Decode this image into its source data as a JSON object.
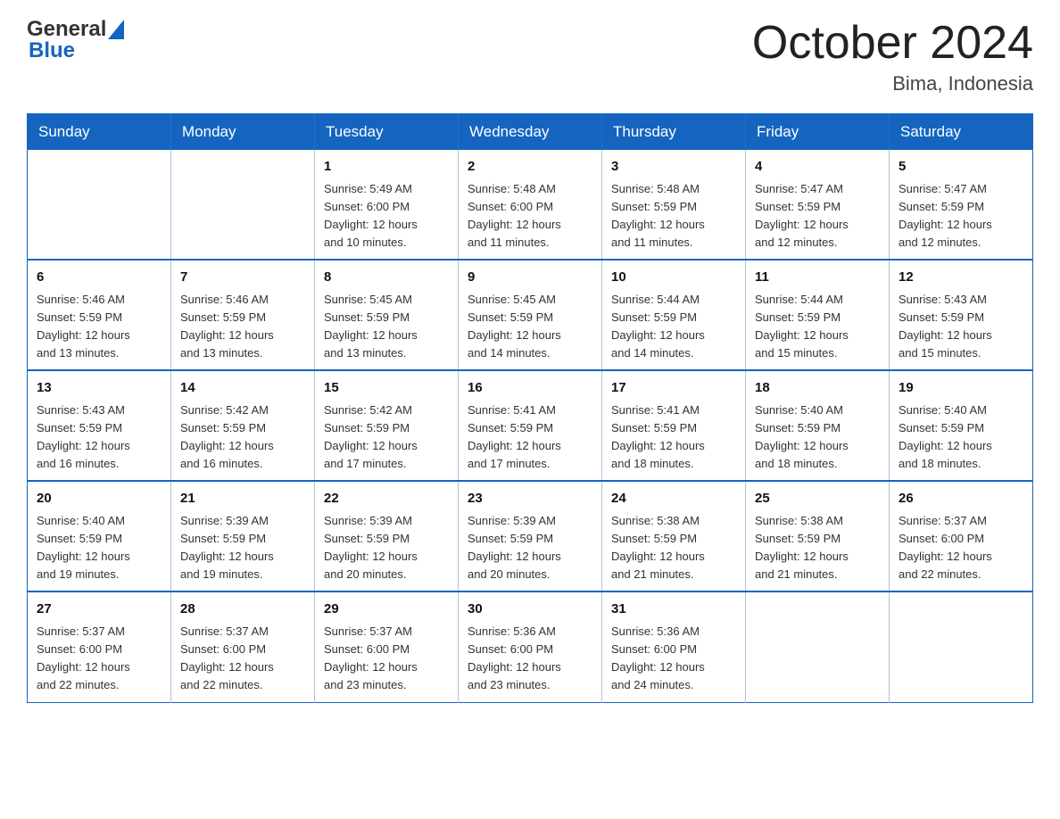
{
  "header": {
    "logo_text_general": "General",
    "logo_text_blue": "Blue",
    "month_title": "October 2024",
    "location": "Bima, Indonesia"
  },
  "calendar": {
    "days_of_week": [
      "Sunday",
      "Monday",
      "Tuesday",
      "Wednesday",
      "Thursday",
      "Friday",
      "Saturday"
    ],
    "weeks": [
      [
        {
          "day": "",
          "info": ""
        },
        {
          "day": "",
          "info": ""
        },
        {
          "day": "1",
          "info": "Sunrise: 5:49 AM\nSunset: 6:00 PM\nDaylight: 12 hours\nand 10 minutes."
        },
        {
          "day": "2",
          "info": "Sunrise: 5:48 AM\nSunset: 6:00 PM\nDaylight: 12 hours\nand 11 minutes."
        },
        {
          "day": "3",
          "info": "Sunrise: 5:48 AM\nSunset: 5:59 PM\nDaylight: 12 hours\nand 11 minutes."
        },
        {
          "day": "4",
          "info": "Sunrise: 5:47 AM\nSunset: 5:59 PM\nDaylight: 12 hours\nand 12 minutes."
        },
        {
          "day": "5",
          "info": "Sunrise: 5:47 AM\nSunset: 5:59 PM\nDaylight: 12 hours\nand 12 minutes."
        }
      ],
      [
        {
          "day": "6",
          "info": "Sunrise: 5:46 AM\nSunset: 5:59 PM\nDaylight: 12 hours\nand 13 minutes."
        },
        {
          "day": "7",
          "info": "Sunrise: 5:46 AM\nSunset: 5:59 PM\nDaylight: 12 hours\nand 13 minutes."
        },
        {
          "day": "8",
          "info": "Sunrise: 5:45 AM\nSunset: 5:59 PM\nDaylight: 12 hours\nand 13 minutes."
        },
        {
          "day": "9",
          "info": "Sunrise: 5:45 AM\nSunset: 5:59 PM\nDaylight: 12 hours\nand 14 minutes."
        },
        {
          "day": "10",
          "info": "Sunrise: 5:44 AM\nSunset: 5:59 PM\nDaylight: 12 hours\nand 14 minutes."
        },
        {
          "day": "11",
          "info": "Sunrise: 5:44 AM\nSunset: 5:59 PM\nDaylight: 12 hours\nand 15 minutes."
        },
        {
          "day": "12",
          "info": "Sunrise: 5:43 AM\nSunset: 5:59 PM\nDaylight: 12 hours\nand 15 minutes."
        }
      ],
      [
        {
          "day": "13",
          "info": "Sunrise: 5:43 AM\nSunset: 5:59 PM\nDaylight: 12 hours\nand 16 minutes."
        },
        {
          "day": "14",
          "info": "Sunrise: 5:42 AM\nSunset: 5:59 PM\nDaylight: 12 hours\nand 16 minutes."
        },
        {
          "day": "15",
          "info": "Sunrise: 5:42 AM\nSunset: 5:59 PM\nDaylight: 12 hours\nand 17 minutes."
        },
        {
          "day": "16",
          "info": "Sunrise: 5:41 AM\nSunset: 5:59 PM\nDaylight: 12 hours\nand 17 minutes."
        },
        {
          "day": "17",
          "info": "Sunrise: 5:41 AM\nSunset: 5:59 PM\nDaylight: 12 hours\nand 18 minutes."
        },
        {
          "day": "18",
          "info": "Sunrise: 5:40 AM\nSunset: 5:59 PM\nDaylight: 12 hours\nand 18 minutes."
        },
        {
          "day": "19",
          "info": "Sunrise: 5:40 AM\nSunset: 5:59 PM\nDaylight: 12 hours\nand 18 minutes."
        }
      ],
      [
        {
          "day": "20",
          "info": "Sunrise: 5:40 AM\nSunset: 5:59 PM\nDaylight: 12 hours\nand 19 minutes."
        },
        {
          "day": "21",
          "info": "Sunrise: 5:39 AM\nSunset: 5:59 PM\nDaylight: 12 hours\nand 19 minutes."
        },
        {
          "day": "22",
          "info": "Sunrise: 5:39 AM\nSunset: 5:59 PM\nDaylight: 12 hours\nand 20 minutes."
        },
        {
          "day": "23",
          "info": "Sunrise: 5:39 AM\nSunset: 5:59 PM\nDaylight: 12 hours\nand 20 minutes."
        },
        {
          "day": "24",
          "info": "Sunrise: 5:38 AM\nSunset: 5:59 PM\nDaylight: 12 hours\nand 21 minutes."
        },
        {
          "day": "25",
          "info": "Sunrise: 5:38 AM\nSunset: 5:59 PM\nDaylight: 12 hours\nand 21 minutes."
        },
        {
          "day": "26",
          "info": "Sunrise: 5:37 AM\nSunset: 6:00 PM\nDaylight: 12 hours\nand 22 minutes."
        }
      ],
      [
        {
          "day": "27",
          "info": "Sunrise: 5:37 AM\nSunset: 6:00 PM\nDaylight: 12 hours\nand 22 minutes."
        },
        {
          "day": "28",
          "info": "Sunrise: 5:37 AM\nSunset: 6:00 PM\nDaylight: 12 hours\nand 22 minutes."
        },
        {
          "day": "29",
          "info": "Sunrise: 5:37 AM\nSunset: 6:00 PM\nDaylight: 12 hours\nand 23 minutes."
        },
        {
          "day": "30",
          "info": "Sunrise: 5:36 AM\nSunset: 6:00 PM\nDaylight: 12 hours\nand 23 minutes."
        },
        {
          "day": "31",
          "info": "Sunrise: 5:36 AM\nSunset: 6:00 PM\nDaylight: 12 hours\nand 24 minutes."
        },
        {
          "day": "",
          "info": ""
        },
        {
          "day": "",
          "info": ""
        }
      ]
    ]
  }
}
